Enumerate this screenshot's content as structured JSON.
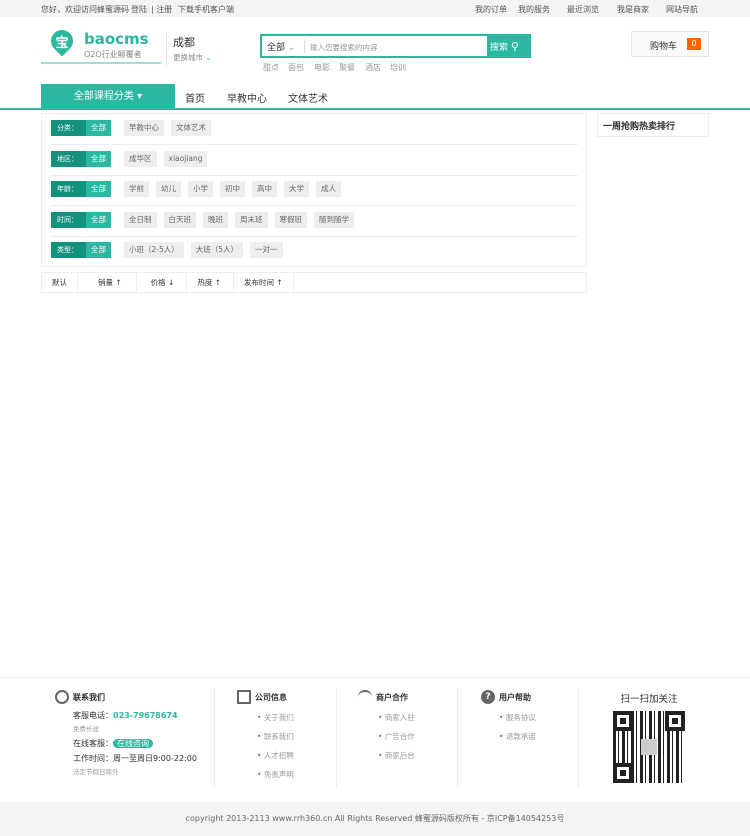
{
  "topbar": {
    "welcome": "您好，欢迎访问蜂蜜源码",
    "login": "登陆",
    "register": "| 注册",
    "download": "下载手机客户端",
    "links": [
      "我的订单",
      "我的服务",
      "最近浏览",
      "我是商家",
      "网站导航"
    ]
  },
  "logo": {
    "glyph": "宝",
    "brand": "baocms",
    "slogan": "O2O行业颠覆者"
  },
  "city": {
    "name": "成都",
    "change": "更换城市"
  },
  "search": {
    "category": "全部",
    "placeholder": "输入您要搜索的内容",
    "button": "搜索",
    "hotwords": [
      "甜点",
      "面包",
      "电影",
      "聚餐",
      "酒店",
      "培训"
    ]
  },
  "cart": {
    "label": "购物车",
    "count": "0"
  },
  "nav": {
    "all": "全部课程分类 ▾",
    "items": [
      "首页",
      "早教中心",
      "文体艺术"
    ]
  },
  "filters": [
    {
      "label": "分类：",
      "all": "全部",
      "options": [
        "早教中心",
        "文体艺术"
      ]
    },
    {
      "label": "地区：",
      "all": "全部",
      "options": [
        "成华区",
        "xiaojiang"
      ]
    },
    {
      "label": "年龄：",
      "all": "全部",
      "options": [
        "学前",
        "幼儿",
        "小学",
        "初中",
        "高中",
        "大学",
        "成人"
      ]
    },
    {
      "label": "时间：",
      "all": "全部",
      "options": [
        "全日制",
        "白天班",
        "晚班",
        "周末班",
        "寒假班",
        "随到随学"
      ]
    },
    {
      "label": "类型：",
      "all": "全部",
      "options": [
        "小班（2-5人）",
        "大班（5人）",
        "一对一"
      ]
    }
  ],
  "sort": [
    "默认",
    "销量 ↑",
    "价格 ↓",
    "热度 ↑",
    "发布时间 ↑"
  ],
  "sidebar": {
    "rank_title": "一周抢购热卖排行"
  },
  "footer": {
    "contact": {
      "title": "联系我们",
      "phone_label": "客服电话：",
      "phone": "023-79678674",
      "free": "免费长途",
      "online_label": "在线客服：",
      "online_btn": "在线咨询",
      "hours": "工作时间：周一至周日9:00-22:00",
      "holiday": "法定节假日除外"
    },
    "company": {
      "title": "公司信息",
      "items": [
        "关于我们",
        "联系我们",
        "人才招聘",
        "免责声明"
      ]
    },
    "merchant": {
      "title": "商户合作",
      "items": [
        "商家入驻",
        "广告合作",
        "商家后台"
      ]
    },
    "help": {
      "title": "用户帮助",
      "items": [
        "服务协议",
        "退款承诺"
      ]
    },
    "qr_title": "扫一扫加关注",
    "copyright": "copyright 2013-2113 www.rrh360.cn All Rights Reserved 蜂蜜源码版权所有 - 京ICP备14054253号"
  }
}
